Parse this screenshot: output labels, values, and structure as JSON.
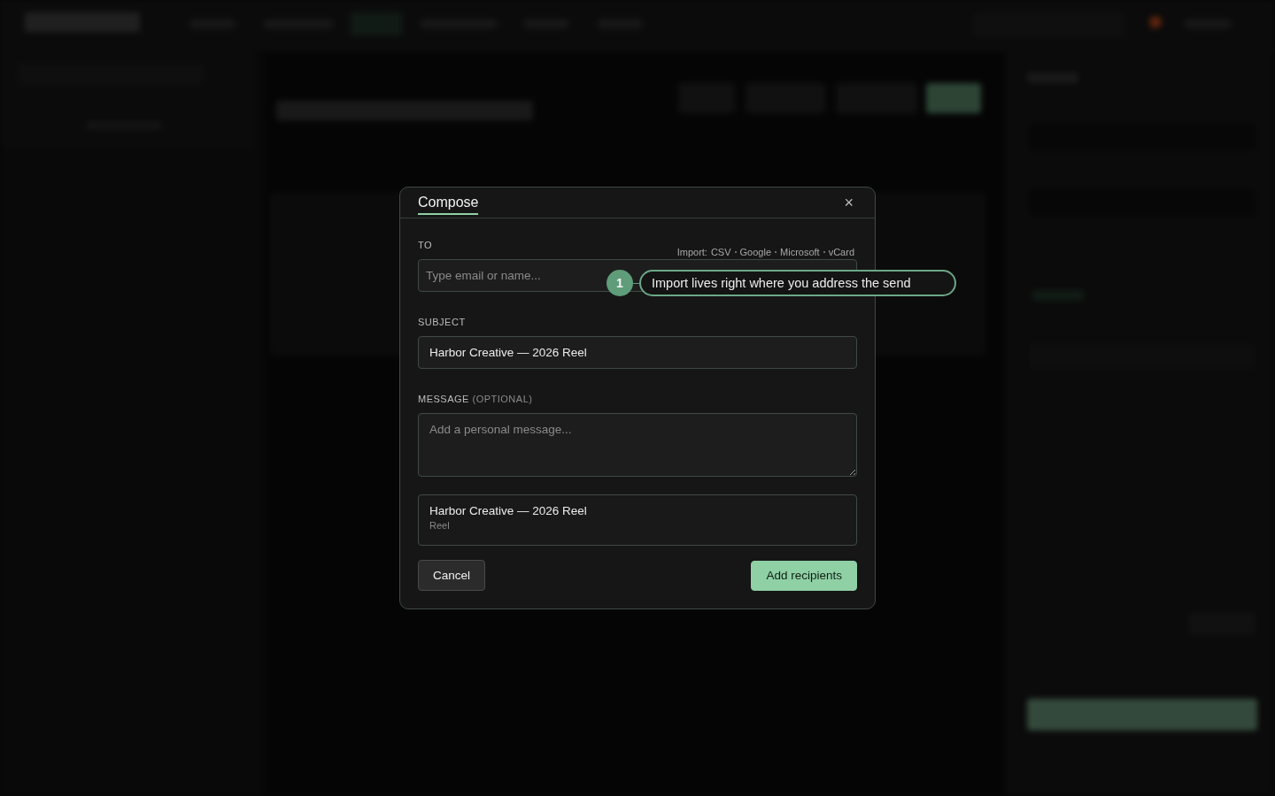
{
  "dialog": {
    "tabs": [
      {
        "label": "Compose",
        "selected": true
      }
    ],
    "close_label": "×",
    "to": {
      "label": "TO",
      "placeholder": "Type email or name...",
      "import_label": "Import:",
      "import_sources": [
        "CSV",
        "Google",
        "Microsoft",
        "vCard"
      ]
    },
    "subject": {
      "label": "SUBJECT",
      "value": "Harbor Creative — 2026 Reel"
    },
    "message": {
      "label": "MESSAGE",
      "hint": "(OPTIONAL)",
      "placeholder": "Add a personal message..."
    },
    "attachment": {
      "title": "Harbor Creative — 2026 Reel",
      "subtitle": "Reel"
    },
    "buttons": [
      {
        "label": "Cancel",
        "kind": "secondary"
      },
      {
        "label": "Add recipients",
        "kind": "primary"
      }
    ]
  },
  "coach_mark": {
    "step": "1",
    "text": "Import lives right where you address the send"
  }
}
